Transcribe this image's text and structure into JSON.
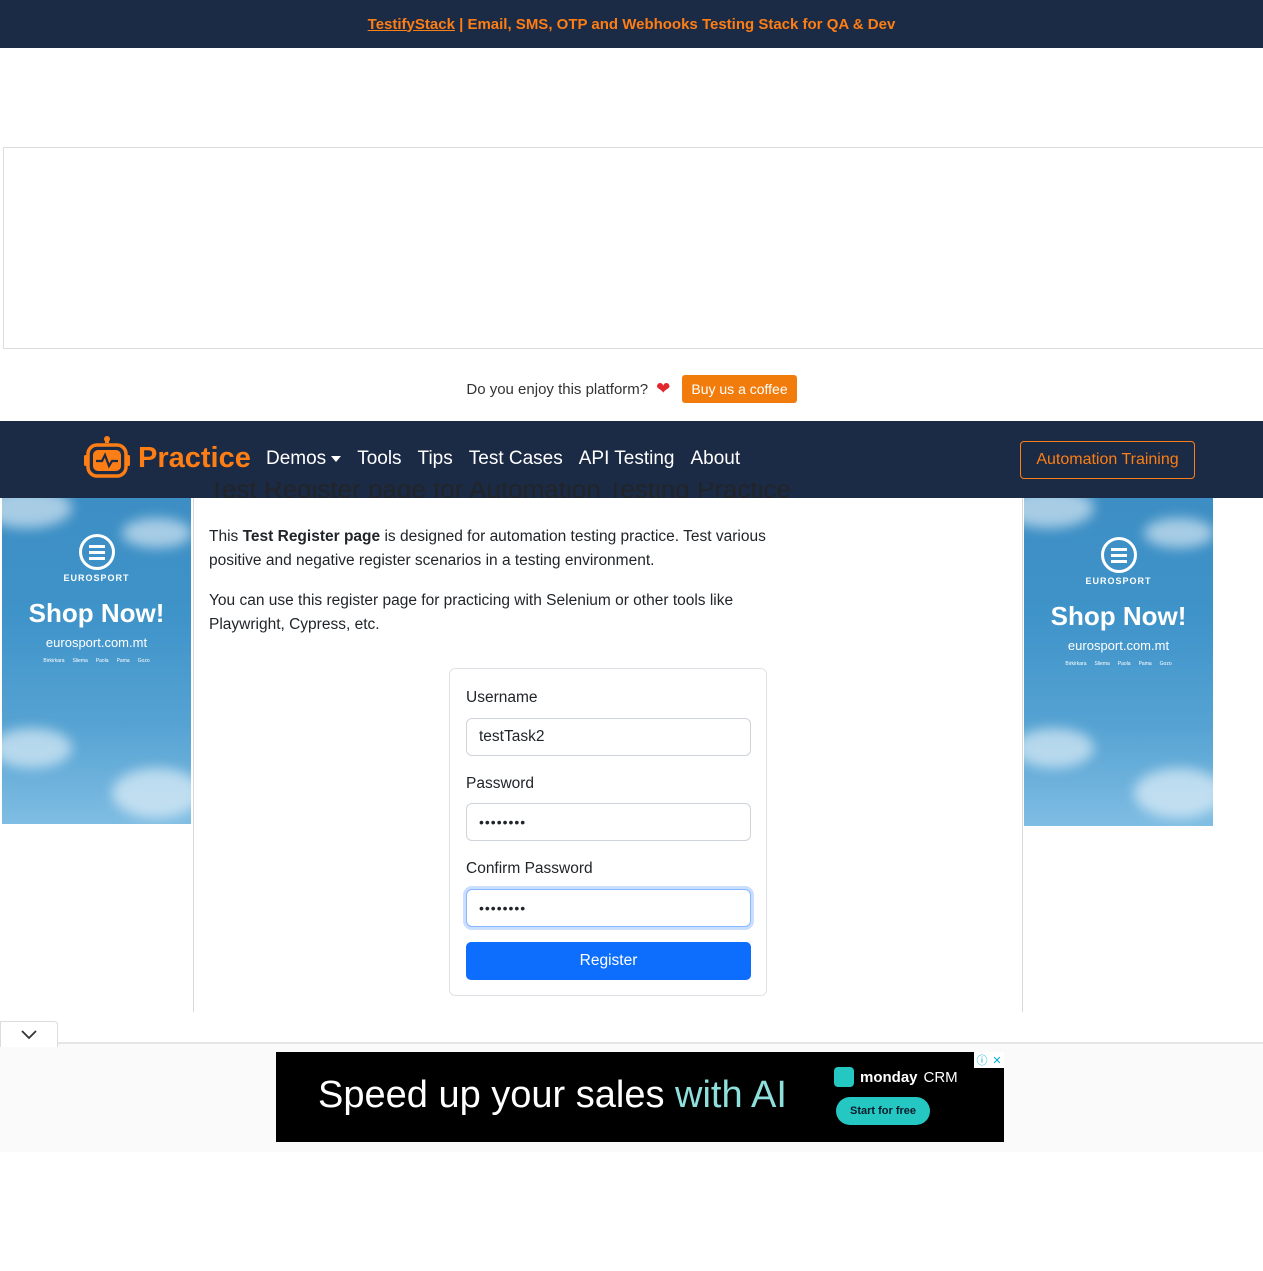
{
  "top_banner": {
    "link_text": "TestifyStack",
    "text": " | Email, SMS, OTP and Webhooks Testing Stack for QA & Dev"
  },
  "enjoy": {
    "question": "Do you enjoy this platform?",
    "coffee_button": "Buy us a coffee"
  },
  "navbar": {
    "brand": "Practice",
    "links": [
      "Demos",
      "Tools",
      "Tips",
      "Test Cases",
      "API Testing",
      "About"
    ],
    "training_button": "Automation Training"
  },
  "side_ads": {
    "logo_name": "EUROSPORT",
    "headline": "Shop Now!",
    "url": "eurosport.com.mt",
    "locations": [
      "Birkirkara",
      "Sliema",
      "Paola",
      "Pama",
      "Gozo"
    ]
  },
  "main": {
    "title": "Test Register page for Automation Testing Practice",
    "para1_prefix": "This ",
    "para1_bold": "Test Register page",
    "para1_suffix": " is designed for automation testing practice. Test various positive and negative register scenarios in a testing environment.",
    "para2": "You can use this register page for practicing with Selenium or other tools like Playwright, Cypress, etc."
  },
  "form": {
    "username_label": "Username",
    "username_value": "testTask2",
    "password_label": "Password",
    "password_value": "••••••••",
    "confirm_label": "Confirm Password",
    "confirm_value": "••••••••",
    "register_button": "Register"
  },
  "bottom_ad": {
    "text_main": "Speed up your sales ",
    "text_accent": "with AI",
    "brand": "monday",
    "brand_suffix": "CRM",
    "cta": "Start for free"
  },
  "colors": {
    "navy": "#1b2a45",
    "orange": "#fd7e14",
    "primary": "#0d6efd"
  }
}
